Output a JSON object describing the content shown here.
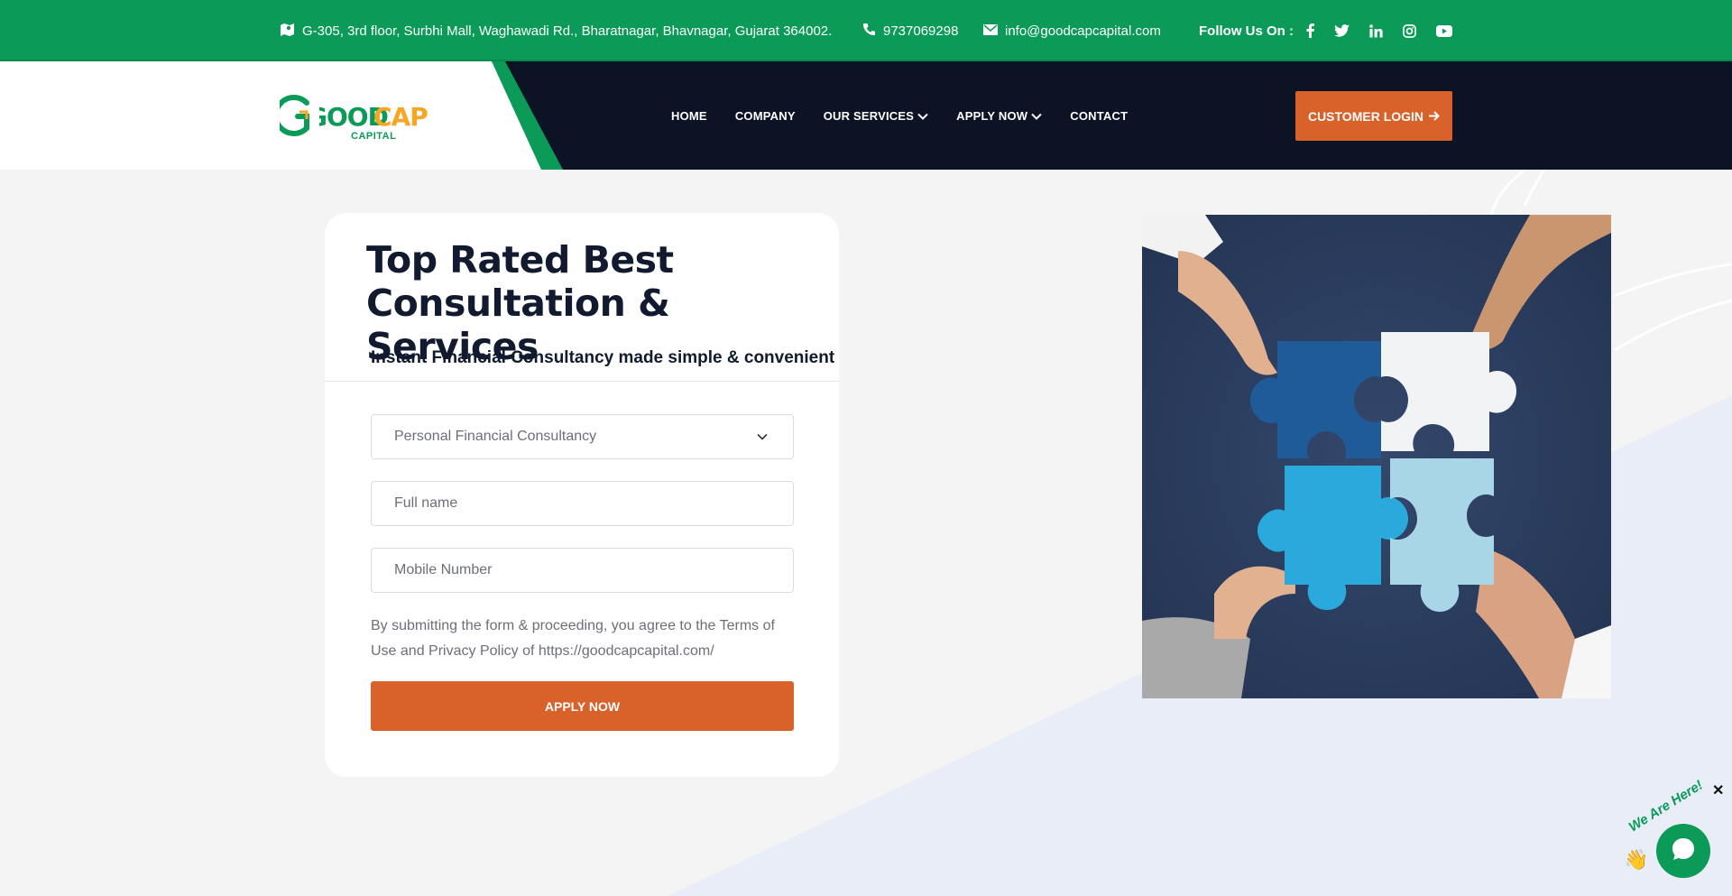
{
  "topbar": {
    "address": "G-305, 3rd floor, Surbhi Mall, Waghawadi Rd., Bharatnagar, Bhavnagar, Gujarat 364002.",
    "phone": "9737069298",
    "email": "info@goodcapcapital.com",
    "follow_label": "Follow Us On :",
    "social_icons": [
      "facebook-icon",
      "twitter-icon",
      "linkedin-icon",
      "instagram-icon",
      "youtube-icon"
    ]
  },
  "header": {
    "logo": {
      "word_good": "GOOD",
      "word_cap": "CAP",
      "word_capital": "CAPITAL"
    },
    "nav": [
      {
        "label": "HOME"
      },
      {
        "label": "COMPANY"
      },
      {
        "label": "OUR SERVICES"
      },
      {
        "label": "APPLY NOW"
      },
      {
        "label": "CONTACT"
      }
    ],
    "login_label": "CUSTOMER LOGIN"
  },
  "form_card": {
    "title_line1": "Top Rated Best",
    "title_line2": "Consultation & Services",
    "subtitle": "Instant Financial Consultancy made simple & convenient",
    "service_select": "Personal Financial Consultancy",
    "name_placeholder": "Full name",
    "mobile_placeholder": "Mobile Number",
    "terms": "By submitting the form & proceeding, you agree to the Terms of Use and Privacy Policy of https://goodcapcapital.com/",
    "apply_label": "APPLY NOW"
  },
  "chat_widget": {
    "label": "We Are Here!",
    "close_symbol": "✕"
  },
  "colors": {
    "green": "#0b9a58",
    "navy": "#0b1325",
    "orange": "#d9612a"
  }
}
